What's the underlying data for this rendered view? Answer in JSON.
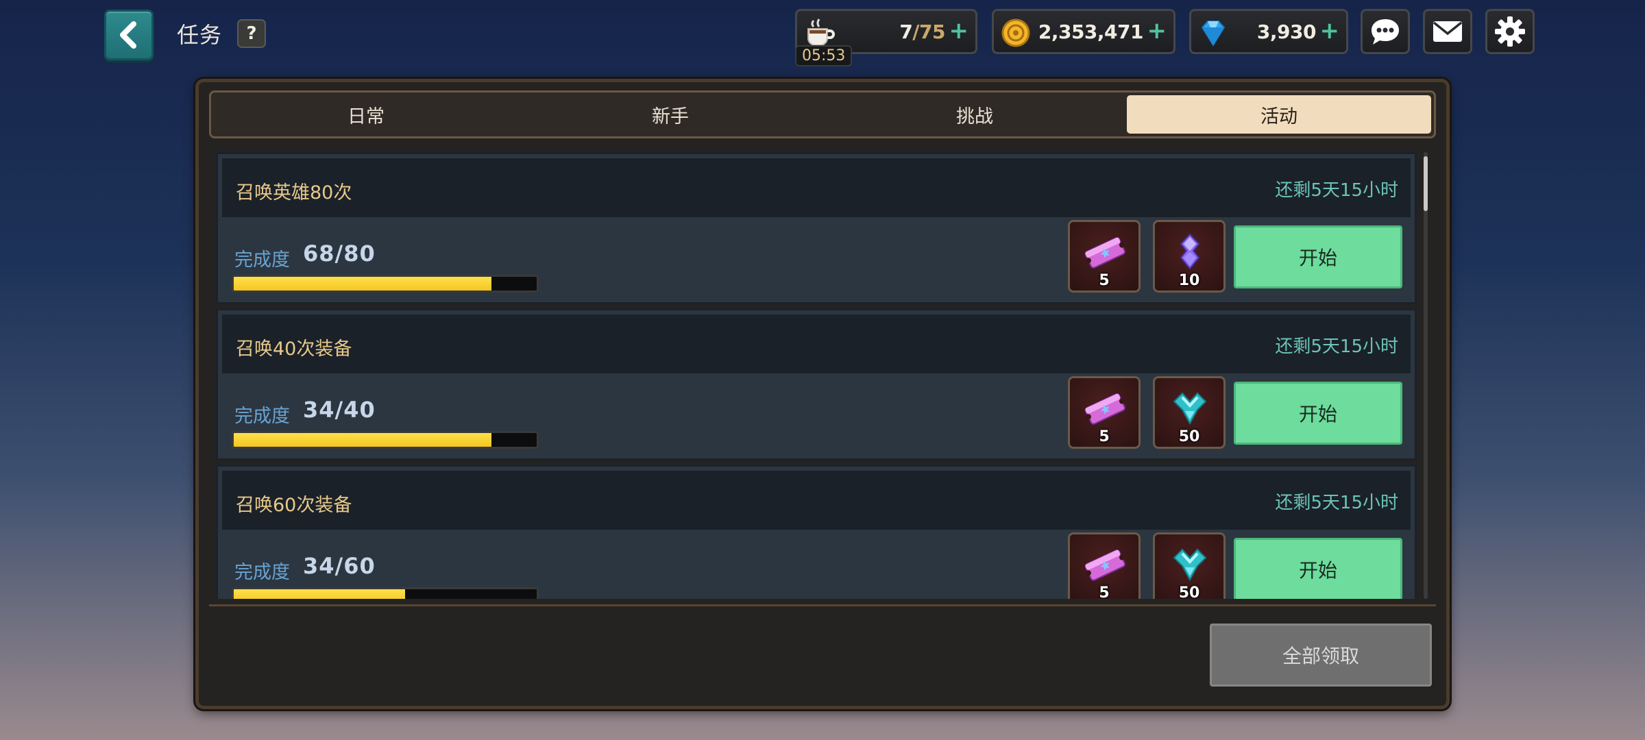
{
  "header": {
    "title": "任务",
    "help_label": "?"
  },
  "resources": {
    "stamina": {
      "icon": "coffee-cup-icon",
      "current": "7",
      "max": "/75",
      "timer": "05:53"
    },
    "gold": {
      "icon": "gold-coin-icon",
      "value": "2,353,471"
    },
    "gems": {
      "icon": "blue-gem-icon",
      "value": "3,930"
    },
    "plus_label": "+"
  },
  "tabs": [
    {
      "label": "日常",
      "active": false
    },
    {
      "label": "新手",
      "active": false
    },
    {
      "label": "挑战",
      "active": false
    },
    {
      "label": "活动",
      "active": true
    }
  ],
  "quests": [
    {
      "name": "召唤英雄80次",
      "time_left": "还剩5天15小时",
      "progress_label": "完成度",
      "progress": "68/80",
      "fraction": 0.85,
      "rewards": [
        {
          "icon": "summon-ticket-icon",
          "count": "5"
        },
        {
          "icon": "purple-crystal-icon",
          "count": "10"
        }
      ],
      "button": "开始"
    },
    {
      "name": "召唤40次装备",
      "time_left": "还剩5天15小时",
      "progress_label": "完成度",
      "progress": "34/40",
      "fraction": 0.85,
      "rewards": [
        {
          "icon": "summon-ticket-icon",
          "count": "5"
        },
        {
          "icon": "teal-crystal-icon",
          "count": "50"
        }
      ],
      "button": "开始"
    },
    {
      "name": "召唤60次装备",
      "time_left": "还剩5天15小时",
      "progress_label": "完成度",
      "progress": "34/60",
      "fraction": 0.5667,
      "rewards": [
        {
          "icon": "summon-ticket-icon",
          "count": "5"
        },
        {
          "icon": "teal-crystal-icon",
          "count": "50"
        }
      ],
      "button": "开始"
    }
  ],
  "footer": {
    "claim_all": "全部领取"
  },
  "colors": {
    "accent_green": "#6ddc9c",
    "progress_yellow": "#f3c623",
    "tab_active": "#f1dcbe",
    "time_text": "#6cc4b8",
    "quest_title": "#e8c98a"
  }
}
